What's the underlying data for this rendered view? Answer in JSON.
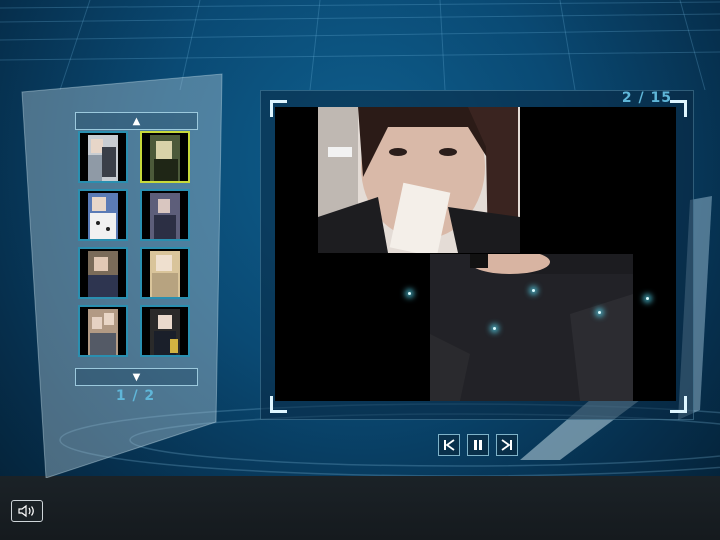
{
  "gallery": {
    "page_label": "1 / 2",
    "thumbnails": [
      {
        "name": "thumb-1",
        "selected": false
      },
      {
        "name": "thumb-2",
        "selected": true
      },
      {
        "name": "thumb-3",
        "selected": false
      },
      {
        "name": "thumb-4",
        "selected": false
      },
      {
        "name": "thumb-5",
        "selected": false
      },
      {
        "name": "thumb-6",
        "selected": false
      },
      {
        "name": "thumb-7",
        "selected": false
      },
      {
        "name": "thumb-8",
        "selected": false
      }
    ],
    "up_icon": "triangle-up-icon",
    "down_icon": "triangle-down-icon"
  },
  "viewer": {
    "counter": "2 / 15"
  },
  "controls": {
    "first_icon": "skip-first-icon",
    "pause_icon": "pause-icon",
    "last_icon": "skip-last-icon",
    "volume_icon": "speaker-icon"
  },
  "colors": {
    "accent": "#5fb6d8",
    "selected_border": "#c8d93a",
    "thumb_border": "#2a8fb0"
  }
}
